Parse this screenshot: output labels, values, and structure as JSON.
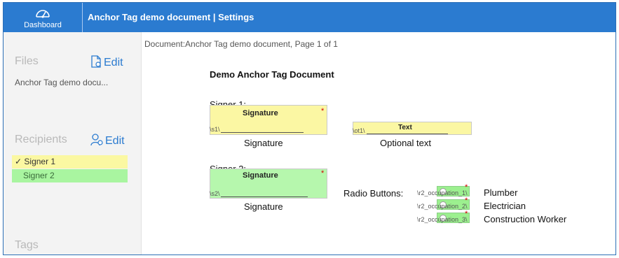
{
  "topbar": {
    "dashboard_label": "Dashboard",
    "title": "Anchor Tag demo document | Settings"
  },
  "sidebar": {
    "files_heading": "Files",
    "files_edit": "Edit",
    "file_name": "Anchor Tag demo docu...",
    "recipients_heading": "Recipients",
    "recipients_edit": "Edit",
    "recipients": [
      {
        "label": "Signer 1",
        "selected_mark": "✓"
      },
      {
        "label": "Signer 2"
      }
    ],
    "tags_heading": "Tags"
  },
  "document": {
    "breadcrumb": "Document:Anchor Tag demo document, Page 1 of 1",
    "title": "Demo Anchor Tag Document",
    "signer1_label": "Signer 1:",
    "signer1_sig_field": "Signature",
    "signer1_anchor": "\\s1\\",
    "signer1_caption": "Signature",
    "text_field": "Text",
    "text_anchor": "\\ot1\\",
    "text_caption": "Optional text",
    "signer2_label": "Signer 2:",
    "signer2_sig_field": "Signature",
    "signer2_anchor": "\\s2\\",
    "signer2_caption": "Signature",
    "radio_label": "Radio Buttons:",
    "radios": [
      {
        "anchor": "\\r2_occupation_1\\",
        "label": "Plumber"
      },
      {
        "anchor": "\\r2_occupation_2\\",
        "label": "Electrician"
      },
      {
        "anchor": "\\r2_occupation_3\\",
        "label": "Construction Worker"
      }
    ],
    "required_mark": "*"
  },
  "colors": {
    "topbar": "#2b7bd0",
    "signer1": "#fbf7a3",
    "signer2": "#b6f7ad",
    "required": "#d40000"
  }
}
